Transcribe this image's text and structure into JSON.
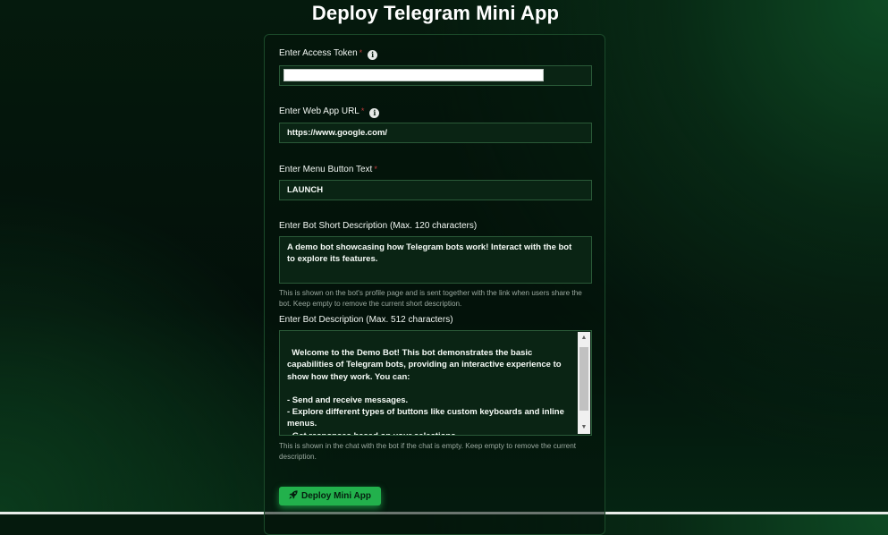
{
  "page": {
    "title": "Deploy Telegram Mini App"
  },
  "form": {
    "access_token": {
      "label": "Enter Access Token",
      "required_mark": "*",
      "info_icon": "info-icon"
    },
    "web_app_url": {
      "label": "Enter Web App URL",
      "required_mark": "*",
      "info_icon": "info-icon",
      "value": "https://www.google.com/"
    },
    "menu_button_text": {
      "label": "Enter Menu Button Text",
      "required_mark": "*",
      "value": "LAUNCH"
    },
    "short_description": {
      "label": "Enter Bot Short Description (Max. 120 characters)",
      "value": "A demo bot showcasing how Telegram bots work! Interact with the bot to explore its features.",
      "helper": "This is shown on the bot's profile page and is sent together with the link when users share the bot. Keep empty to remove the current short description."
    },
    "description": {
      "label": "Enter Bot Description (Max. 512 characters)",
      "value": "Welcome to the Demo Bot! This bot demonstrates the basic capabilities of Telegram bots, providing an interactive experience to show how they work. You can:\n\n- Send and receive messages.\n- Explore different types of buttons like custom keyboards and inline menus.\n- Get responses based on your selections.\n- Test out various bot commands in a real-time environment.",
      "helper": "This is shown in the chat with the bot if the chat is empty. Keep empty to remove the current description."
    },
    "deploy_button": {
      "label": "Deploy Mini App",
      "icon": "rocket-icon"
    }
  },
  "colors": {
    "accent": "#22b14c",
    "required": "#c13b3b",
    "input_border": "#2a5a38"
  }
}
